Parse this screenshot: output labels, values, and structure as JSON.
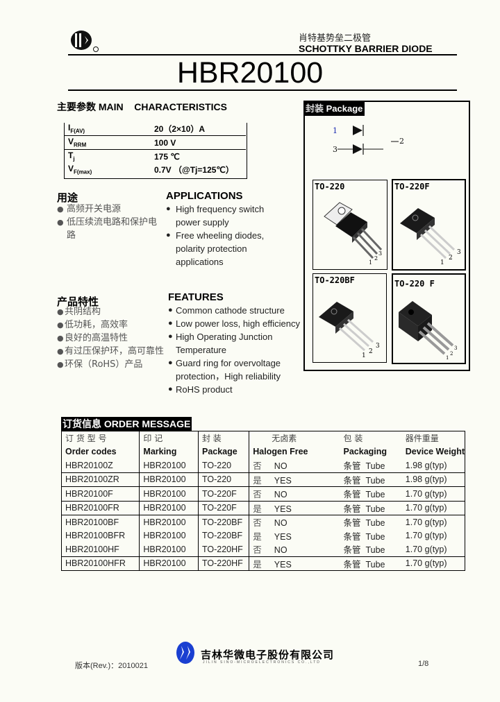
{
  "header": {
    "title_cn": "肖特基势垒二极管",
    "title_en": "SCHOTTKY BARRIER DIODE",
    "part_number": "HBR20100",
    "logo": "jsmc-logo-icon",
    "registered_mark": "®"
  },
  "main_characteristics": {
    "heading_cn": "主要参数",
    "heading_en": "MAIN    CHARACTERISTICS",
    "rows": [
      {
        "symbol": "I",
        "sub": "F(AV)",
        "value": "20（2×10）A"
      },
      {
        "symbol": "V",
        "sub": "RRM",
        "value": "100 V"
      },
      {
        "symbol": "T",
        "sub": "j",
        "value": "175 ℃"
      },
      {
        "symbol": "V",
        "sub": "F(max)",
        "value": "0.7V  （@Tj=125℃）"
      }
    ]
  },
  "applications": {
    "heading_cn": "用途",
    "heading_en": "APPLICATIONS",
    "items_cn": [
      "高频开关电源",
      "低压续流电路和保护电路"
    ],
    "items_en": [
      "High frequency switch power supply",
      "Free wheeling diodes, polarity protection applications"
    ]
  },
  "features": {
    "heading_cn": "产品特性",
    "heading_en": "FEATURES",
    "items_cn": [
      "共阴结构",
      "低功耗，高效率",
      "良好的高温特性",
      "有过压保护环，高可靠性",
      "环保（RoHS）产品"
    ],
    "items_en": [
      "Common cathode structure",
      "Low power loss, high efficiency",
      "High Operating Junction Temperature",
      "Guard ring for overvoltage protection，High reliability",
      "RoHS product"
    ]
  },
  "package": {
    "heading_cn": "封装",
    "heading_en": "Package",
    "pin_labels": [
      "1",
      "2",
      "3"
    ],
    "packages": [
      "TO-220",
      "TO-220F",
      "TO-220BF",
      "TO-220 F"
    ],
    "pin_numbers": [
      "1",
      "2",
      "3"
    ]
  },
  "order": {
    "heading_cn": "订货信息",
    "heading_en": "ORDER MESSAGE",
    "columns_cn": [
      "订 货 型 号",
      "印      记",
      "封      装",
      "无卤素",
      "包        装",
      "器件重量"
    ],
    "columns_en": [
      "Order codes",
      "Marking",
      "Package",
      "Halogen Free",
      "Packaging",
      "Device Weight"
    ],
    "rows": [
      {
        "code": "HBR20100Z",
        "marking": "HBR20100",
        "package": "TO-220",
        "hf_cn": "否",
        "hf": "NO",
        "packaging": "条管  Tube",
        "weight": "1.98 g(typ)"
      },
      {
        "code": "HBR20100ZR",
        "marking": "HBR20100",
        "package": "TO-220",
        "hf_cn": "是",
        "hf": "YES",
        "packaging": "条管  Tube",
        "weight": "1.98 g(typ)"
      },
      {
        "code": "HBR20100F",
        "marking": "HBR20100",
        "package": "TO-220F",
        "hf_cn": "否",
        "hf": "NO",
        "packaging": "条管  Tube",
        "weight": "1.70 g(typ)"
      },
      {
        "code": "HBR20100FR",
        "marking": "HBR20100",
        "package": "TO-220F",
        "hf_cn": "是",
        "hf": "YES",
        "packaging": "条管  Tube",
        "weight": "1.70 g(typ)"
      },
      {
        "code": "HBR20100BF",
        "marking": "HBR20100",
        "package": "TO-220BF",
        "hf_cn": "否",
        "hf": "NO",
        "packaging": "条管  Tube",
        "weight": "1.70 g(typ)"
      },
      {
        "code": "HBR20100BFR",
        "marking": "HBR20100",
        "package": "TO-220BF",
        "hf_cn": "是",
        "hf": "YES",
        "packaging": "条管  Tube",
        "weight": "1.70 g(typ)"
      },
      {
        "code": "HBR20100HF",
        "marking": "HBR20100",
        "package": "TO-220HF",
        "hf_cn": "否",
        "hf": "NO",
        "packaging": "条管  Tube",
        "weight": "1.70 g(typ)"
      },
      {
        "code": "HBR20100HFR",
        "marking": "HBR20100",
        "package": "TO-220HF",
        "hf_cn": "是",
        "hf": "YES",
        "packaging": "条管  Tube",
        "weight": "1.70 g(typ)"
      }
    ]
  },
  "footer": {
    "revision": "版本(Rev.)：2010021",
    "company_cn": "吉林华微电子股份有限公司",
    "company_en": "JILIN  SINO-MICROELECTRONICS  CO.,LTD",
    "page": "1/8",
    "logo_color": "#1a3fd1"
  }
}
